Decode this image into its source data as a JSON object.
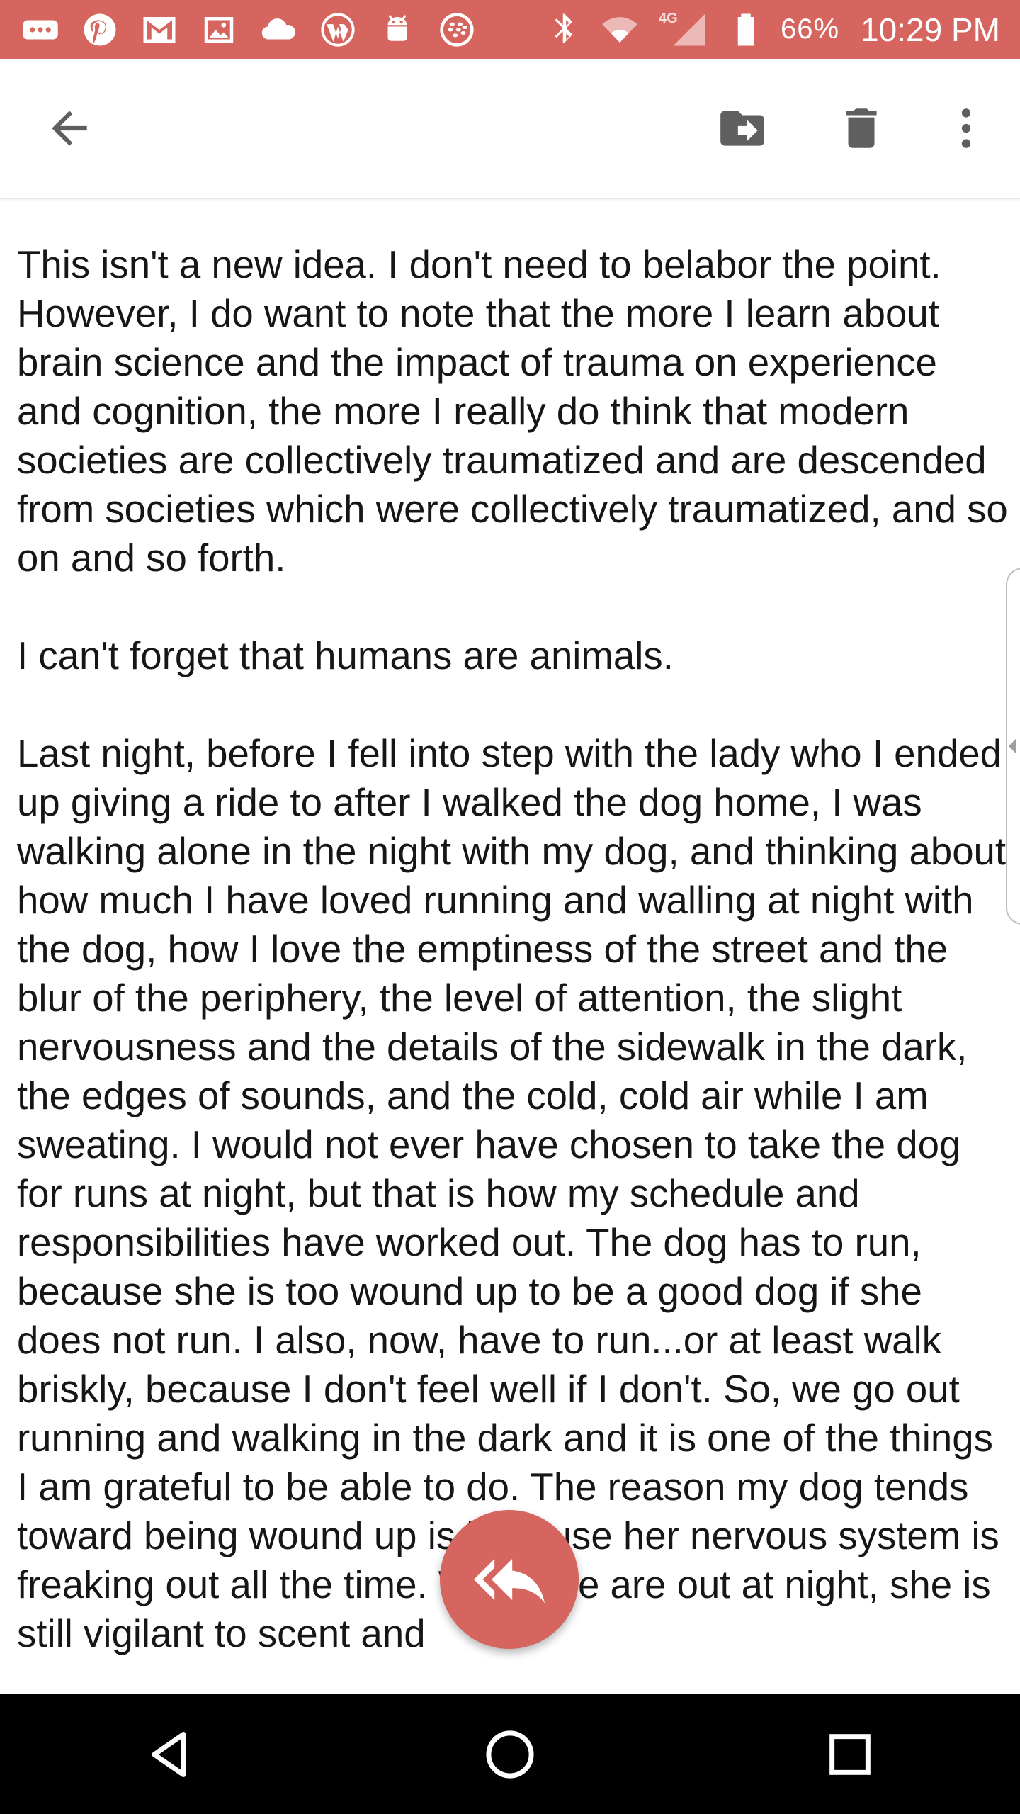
{
  "status_bar": {
    "battery": "66%",
    "time": "10:29 PM",
    "network_label": "4G",
    "left_icons": [
      "more-icon",
      "pinterest-icon",
      "gmail-icon",
      "photo-icon",
      "cloud-icon",
      "wordpress-icon",
      "android-icon",
      "blackberry-icon"
    ],
    "right_icons": [
      "bluetooth-icon",
      "wifi-icon",
      "signal-icon",
      "battery-icon"
    ]
  },
  "toolbar": {
    "icons": [
      "back-arrow-icon",
      "move-to-icon",
      "trash-icon",
      "more-vert-icon"
    ]
  },
  "message": {
    "paragraphs": [
      "This isn't a new idea. I don't need to belabor the point. However, I do want to note that the more I learn about brain science and the impact of trauma on experience and cognition, the more I really do think that modern societies are collectively traumatized and are descended from societies which were collectively traumatized, and so on and so forth.",
      "I can't forget that humans are animals.",
      "Last night, before I fell into step with the lady who I ended up giving a ride to after I walked the dog home, I was walking alone in the night with my dog, and thinking about how much I have loved running and walling at night with the dog, how I love the emptiness of the street and the blur of the periphery, the level of attention, the slight nervousness and the details of the sidewalk in the dark, the edges of sounds, and the cold, cold air while I am sweating. I would not ever have chosen to take the dog for runs at night, but that is how my schedule and responsibilities have worked out. The dog has to run, because she is too wound up to be a good dog if she does not run. I also, now, have to run...or at least walk briskly, because I don't feel well if I don't. So, we go out running and walking in the dark and it is one of the things I am grateful to be able to do. The reason my dog tends toward being wound up is because her nervous system is freaking out all the time. When we are out at night, she is still vigilant to scent and"
    ]
  },
  "fab": {
    "icon": "reply-all-icon"
  },
  "nav_bar": {
    "icons": [
      "back-triangle-icon",
      "home-circle-icon",
      "recents-square-icon"
    ]
  },
  "colors": {
    "accent": "#d5655e",
    "toolbar_icon": "#5f5f5f",
    "text": "#161616",
    "nav_bg": "#000000"
  }
}
